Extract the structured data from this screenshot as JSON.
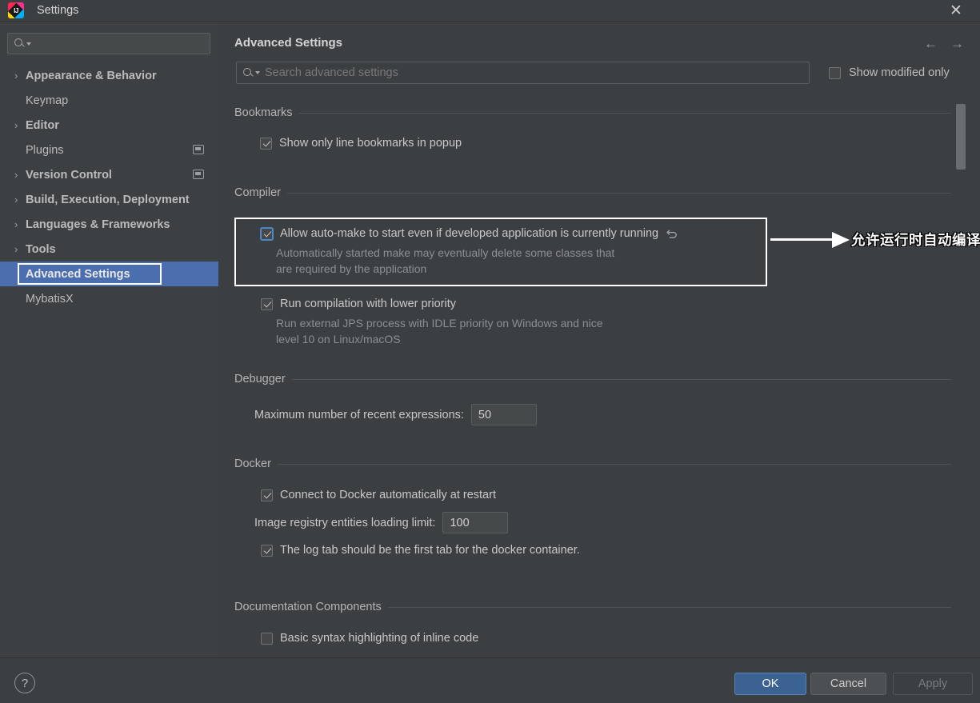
{
  "window": {
    "title": "Settings",
    "logo_icon": "intellij-idea-logo",
    "close_icon": "close-icon"
  },
  "sidebar": {
    "search": {
      "placeholder": "",
      "value": "",
      "icon": "search-icon"
    },
    "items": [
      {
        "label": "Appearance & Behavior",
        "expandable": true,
        "selected": false,
        "scope_icon": false
      },
      {
        "label": "Keymap",
        "expandable": false,
        "selected": false,
        "scope_icon": false
      },
      {
        "label": "Editor",
        "expandable": true,
        "selected": false,
        "scope_icon": false
      },
      {
        "label": "Plugins",
        "expandable": false,
        "selected": false,
        "scope_icon": true
      },
      {
        "label": "Version Control",
        "expandable": true,
        "selected": false,
        "scope_icon": true
      },
      {
        "label": "Build, Execution, Deployment",
        "expandable": true,
        "selected": false,
        "scope_icon": false
      },
      {
        "label": "Languages & Frameworks",
        "expandable": true,
        "selected": false,
        "scope_icon": false
      },
      {
        "label": "Tools",
        "expandable": true,
        "selected": false,
        "scope_icon": false
      },
      {
        "label": "Advanced Settings",
        "expandable": false,
        "selected": true,
        "scope_icon": false
      },
      {
        "label": "MybatisX",
        "expandable": false,
        "selected": false,
        "scope_icon": false
      }
    ]
  },
  "main": {
    "title": "Advanced Settings",
    "nav": {
      "back_icon": "arrow-left-icon",
      "forward_icon": "arrow-right-icon"
    },
    "search": {
      "placeholder": "Search advanced settings",
      "value": "",
      "icon": "search-icon"
    },
    "show_modified_only": {
      "label": "Show modified only",
      "checked": false
    },
    "sections": [
      {
        "name": "Bookmarks",
        "settings": [
          {
            "label": "Show only line bookmarks in popup",
            "checked": true,
            "description": "",
            "modified": false
          }
        ]
      },
      {
        "name": "Compiler",
        "settings": [
          {
            "label": "Allow auto-make to start even if developed application is currently running",
            "checked": true,
            "modified": true,
            "revert_icon": "undo-icon",
            "description_line1": "Automatically started make may eventually delete some classes that",
            "description_line2": "are required by the application"
          },
          {
            "label": "Run compilation with lower priority",
            "checked": true,
            "modified": false,
            "description_line1": "Run external JPS process with IDLE priority on Windows and nice",
            "description_line2": "level 10 on Linux/macOS"
          }
        ]
      },
      {
        "name": "Debugger",
        "fields": [
          {
            "label": "Maximum number of recent expressions:",
            "value": "50"
          }
        ]
      },
      {
        "name": "Docker",
        "settings": [
          {
            "label": "Connect to Docker automatically at restart",
            "checked": true
          },
          {
            "label": "The log tab should be the first tab for the docker container.",
            "checked": true
          }
        ],
        "fields": [
          {
            "label": "Image registry entities loading limit:",
            "value": "100"
          }
        ]
      },
      {
        "name": "Documentation Components",
        "settings": [
          {
            "label": "Basic syntax highlighting of inline code",
            "checked": false
          }
        ]
      }
    ]
  },
  "annotation": {
    "text": "允许运行时自动编译",
    "arrow_icon": "annotation-arrow-icon"
  },
  "footer": {
    "help_label": "?",
    "ok_label": "OK",
    "cancel_label": "Cancel",
    "apply_label": "Apply"
  },
  "colors": {
    "background": "#3c3f41",
    "sidebar_background": "#3c4043",
    "selection": "#4b6eaf",
    "accent_blue": "#4a88c7",
    "ok_button": "#3c6293",
    "annotation": "#ffffff"
  }
}
